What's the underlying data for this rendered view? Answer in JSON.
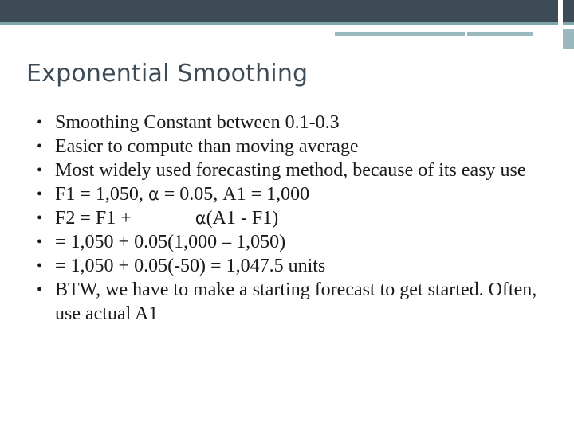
{
  "slide": {
    "title": "Exponential Smoothing",
    "bullets": [
      {
        "parts": [
          {
            "t": "text",
            "v": "Smoothing Constant between 0.1-0.3"
          }
        ]
      },
      {
        "parts": [
          {
            "t": "text",
            "v": "Easier to compute than moving average"
          }
        ]
      },
      {
        "parts": [
          {
            "t": "text",
            "v": "Most widely used forecasting method, because of its easy use"
          }
        ]
      },
      {
        "parts": [
          {
            "t": "text",
            "v": "F1 = 1,050, "
          },
          {
            "t": "alpha",
            "v": "α"
          },
          {
            "t": "text",
            "v": " = 0.05, A1 = 1,000"
          }
        ]
      },
      {
        "parts": [
          {
            "t": "text",
            "v": "F2 = F1 + "
          },
          {
            "t": "gap",
            "v": ""
          },
          {
            "t": "alpha",
            "v": "α"
          },
          {
            "t": "text",
            "v": "(A1 - F1)"
          }
        ]
      },
      {
        "parts": [
          {
            "t": "text",
            "v": "= 1,050 + 0.05(1,000 – 1,050)"
          }
        ]
      },
      {
        "parts": [
          {
            "t": "text",
            "v": "= 1,050 + 0.05(-50) = 1,047.5 units"
          }
        ]
      },
      {
        "parts": [
          {
            "t": "text",
            "v": "BTW, we have to make a starting forecast to get started.  Often, use actual A1"
          }
        ]
      }
    ],
    "colors": {
      "header_dark": "#3d4b56",
      "header_teal": "#7fa7ab",
      "header_teal_light": "#9ab9bc",
      "title_color": "#3d4b56",
      "body_text": "#1a1a1a",
      "background": "#ffffff"
    }
  }
}
